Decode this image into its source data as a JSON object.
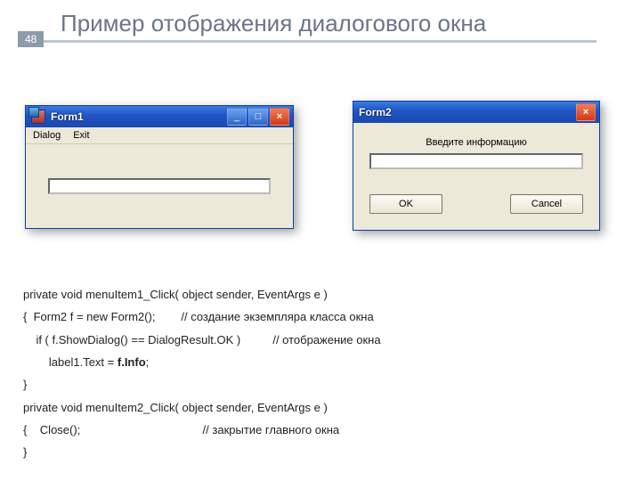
{
  "slide": {
    "title": "Пример отображения диалогового окна",
    "page_number": "48"
  },
  "form1": {
    "title": "Form1",
    "menu": {
      "dialog": "Dialog",
      "exit": "Exit"
    },
    "buttons": {
      "minimize": "_",
      "maximize": "□",
      "close": "×"
    }
  },
  "form2": {
    "title": "Form2",
    "prompt": "Введите информацию",
    "ok": "OK",
    "cancel": "Cancel",
    "buttons": {
      "close": "×"
    }
  },
  "code": {
    "l1": "private void menuItem1_Click( object sender, EventArgs e )",
    "l2a": "{  Form2 f = new Form2();        ",
    "l2b": "// создание экземпляра класса окна",
    "l3a": "    if ( f.ShowDialog() == DialogResult.OK )          ",
    "l3b": "// отображение окна",
    "l4a": "        label1.Text = ",
    "l4b": "f.Info",
    "l4c": ";",
    "l5": "}",
    "l6": "private void menuItem2_Click( object sender, EventArgs e )",
    "l7a": "{    Close();                                      ",
    "l7b": "// закрытие главного окна",
    "l8": "}"
  }
}
